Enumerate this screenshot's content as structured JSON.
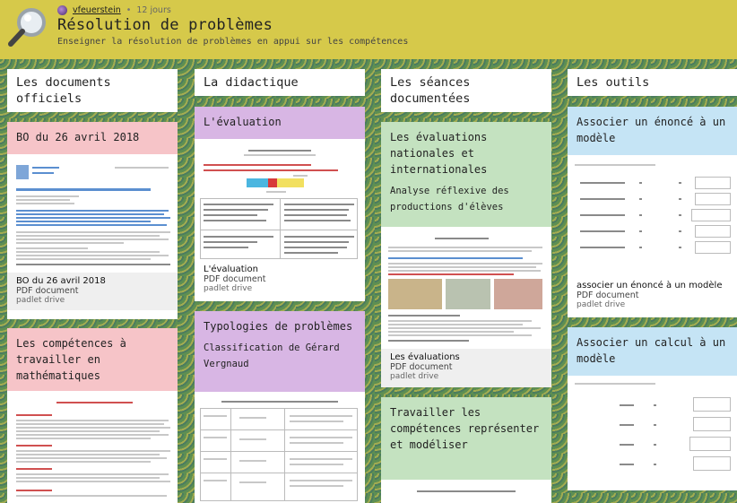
{
  "header": {
    "author": "vfeuerstein",
    "time": "12 jours",
    "title": "Résolution de problèmes",
    "subtitle": "Enseigner la résolution de problèmes en appui sur les compétences"
  },
  "columns": [
    {
      "title": "Les documents officiels",
      "cards": [
        {
          "title": "BO du 26 avril 2018",
          "attachment": {
            "name": "BO du 26 avril 2018",
            "type": "PDF document",
            "source": "padlet drive"
          }
        },
        {
          "title": "Les compétences à travailler en mathématiques"
        }
      ]
    },
    {
      "title": "La didactique",
      "cards": [
        {
          "title": "L'évaluation",
          "attachment": {
            "name": "L'évaluation",
            "type": "PDF document",
            "source": "padlet drive"
          }
        },
        {
          "title": "Typologies de problèmes",
          "body": "Classification de Gérard Vergnaud"
        }
      ]
    },
    {
      "title": "Les séances documentées",
      "cards": [
        {
          "title": "Les évaluations nationales et internationales",
          "body": "Analyse réflexive des productions d'élèves",
          "attachment": {
            "name": "Les évaluations",
            "type": "PDF document",
            "source": "padlet drive"
          }
        },
        {
          "title": "Travailler les compétences représenter et modéliser"
        }
      ]
    },
    {
      "title": "Les outils",
      "cards": [
        {
          "title": "Associer un énoncé à un modèle",
          "attachment": {
            "name": "associer un énoncé à un modèle",
            "type": "PDF document",
            "source": "padlet drive"
          }
        },
        {
          "title": "Associer un calcul à un modèle"
        }
      ]
    }
  ]
}
